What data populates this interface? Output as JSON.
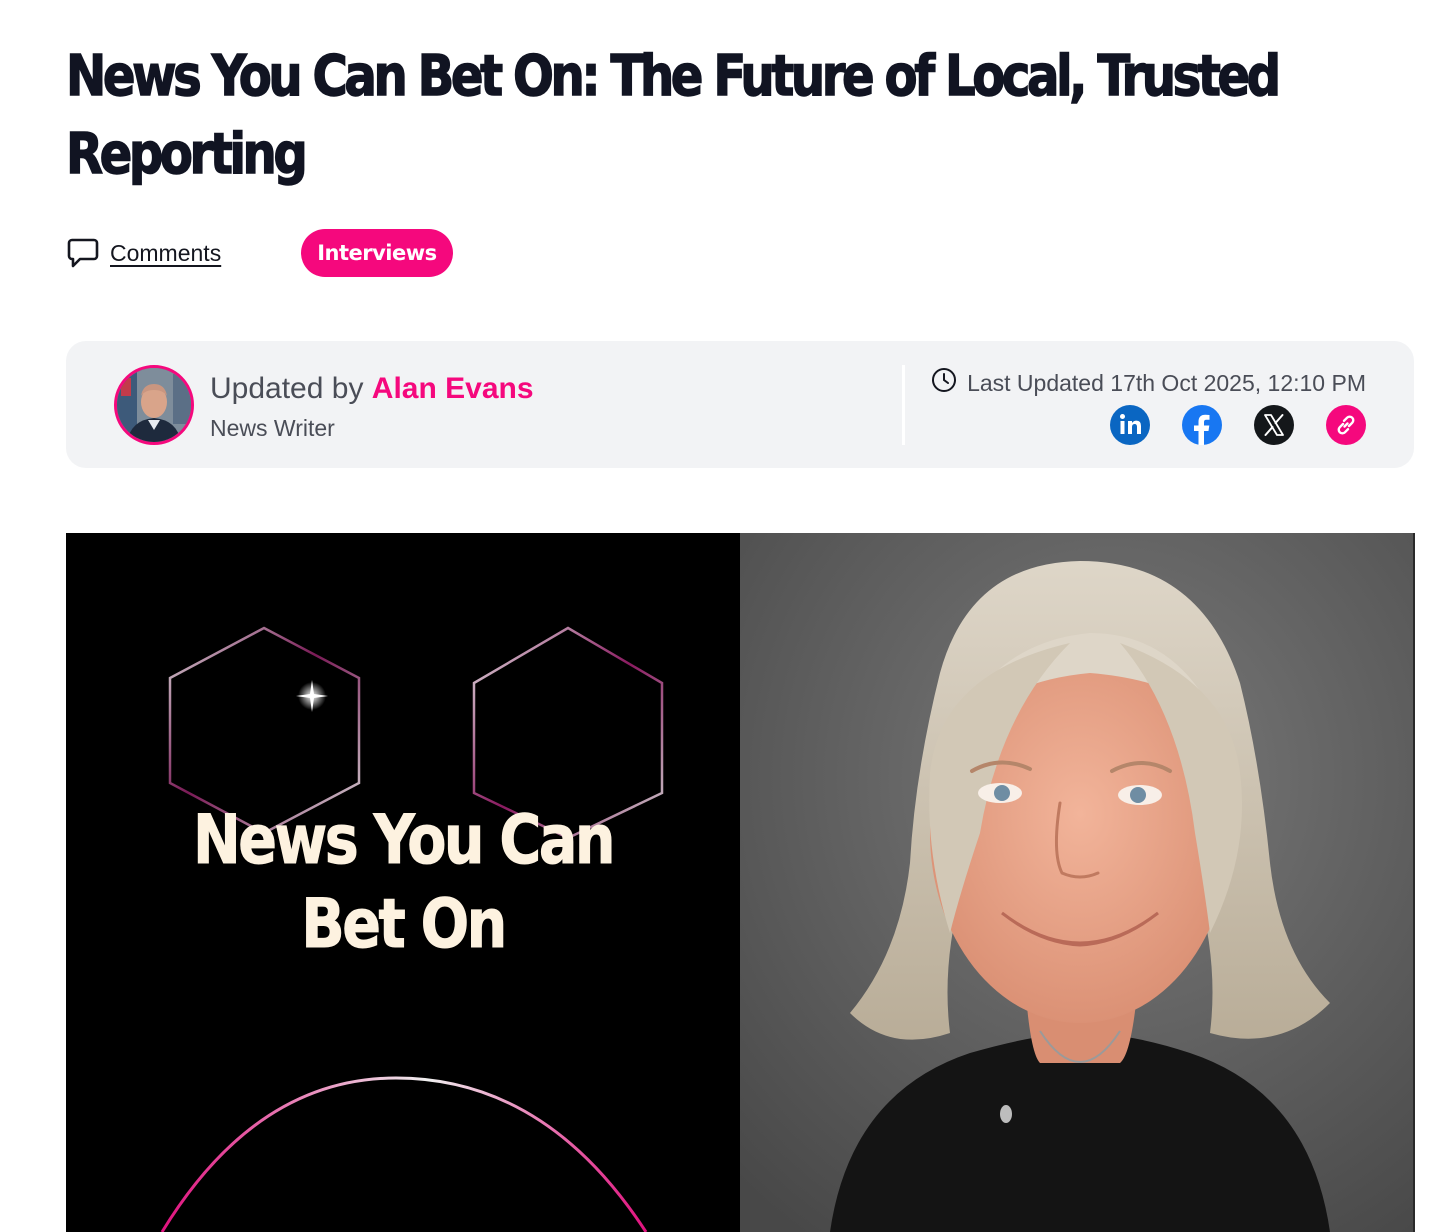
{
  "article": {
    "headline": "News You Can Bet On: The Future of Local, Trusted Reporting",
    "comments_label": "Comments",
    "category": "Interviews"
  },
  "byline": {
    "prefix": "Updated by ",
    "author_name": "Alan Evans",
    "author_role": "News Writer",
    "last_updated": "Last Updated 17th Oct 2025, 12:10 PM"
  },
  "share": {
    "icons": [
      "linkedin-icon",
      "facebook-icon",
      "x-icon",
      "link-icon"
    ]
  },
  "hero": {
    "title_line1": "News You Can",
    "title_line2": "Bet On"
  },
  "colors": {
    "accent": "#f5087d",
    "headline": "#111422",
    "card_bg": "#f2f3f5",
    "linkedin": "#0a66c2",
    "facebook": "#1877f2",
    "x": "#14171a"
  }
}
